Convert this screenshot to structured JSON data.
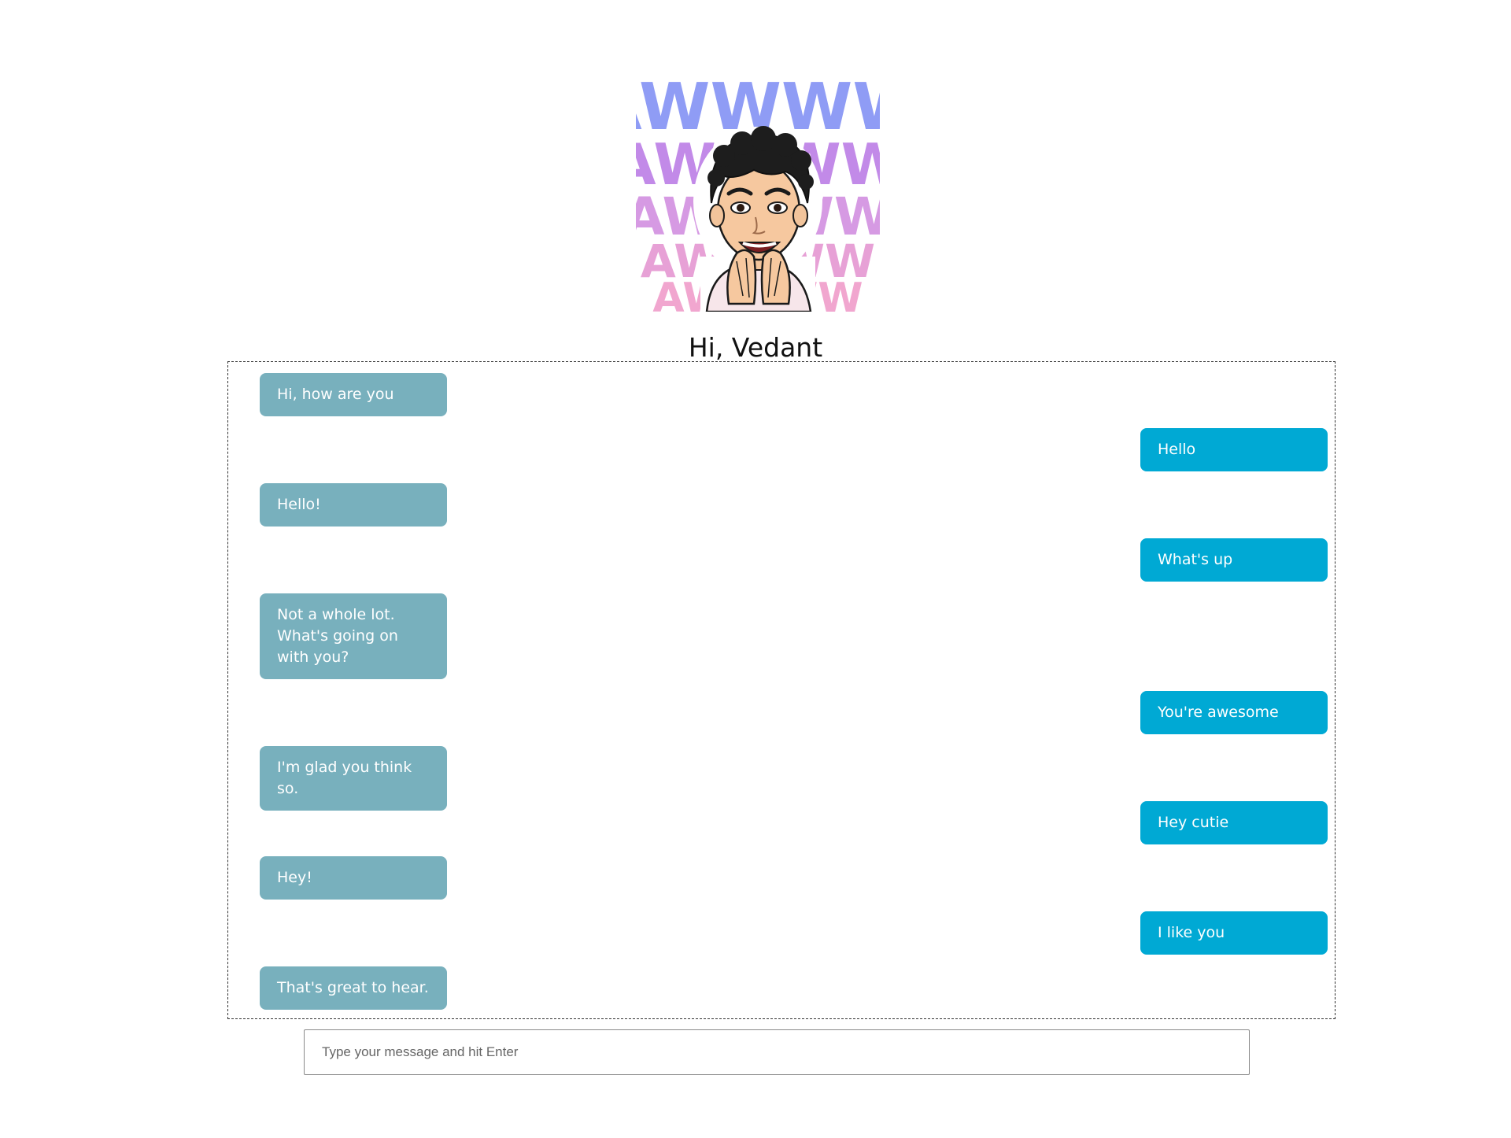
{
  "avatar": {
    "banner_text": "AWWWW",
    "banner_colors": [
      "#8f9cf5",
      "#c28ae8",
      "#d69ae3",
      "#e7a1d6",
      "#f1a6cf"
    ]
  },
  "greeting": "Hi, Vedant",
  "colors": {
    "bot_bubble": "#78b0bd",
    "user_bubble": "#00a9d4"
  },
  "messages": [
    {
      "sender": "bot",
      "text": "Hi, how are you"
    },
    {
      "sender": "user",
      "text": "Hello"
    },
    {
      "sender": "bot",
      "text": "Hello!"
    },
    {
      "sender": "user",
      "text": "What's up"
    },
    {
      "sender": "bot",
      "text": "Not a whole lot. What's going on with you?"
    },
    {
      "sender": "user",
      "text": "You're awesome"
    },
    {
      "sender": "bot",
      "text": "I'm glad you think so."
    },
    {
      "sender": "user",
      "text": "Hey cutie"
    },
    {
      "sender": "bot",
      "text": "Hey!"
    },
    {
      "sender": "user",
      "text": "I like you"
    },
    {
      "sender": "bot",
      "text": "That's great to hear."
    }
  ],
  "input": {
    "placeholder": "Type your message and hit Enter",
    "value": ""
  }
}
